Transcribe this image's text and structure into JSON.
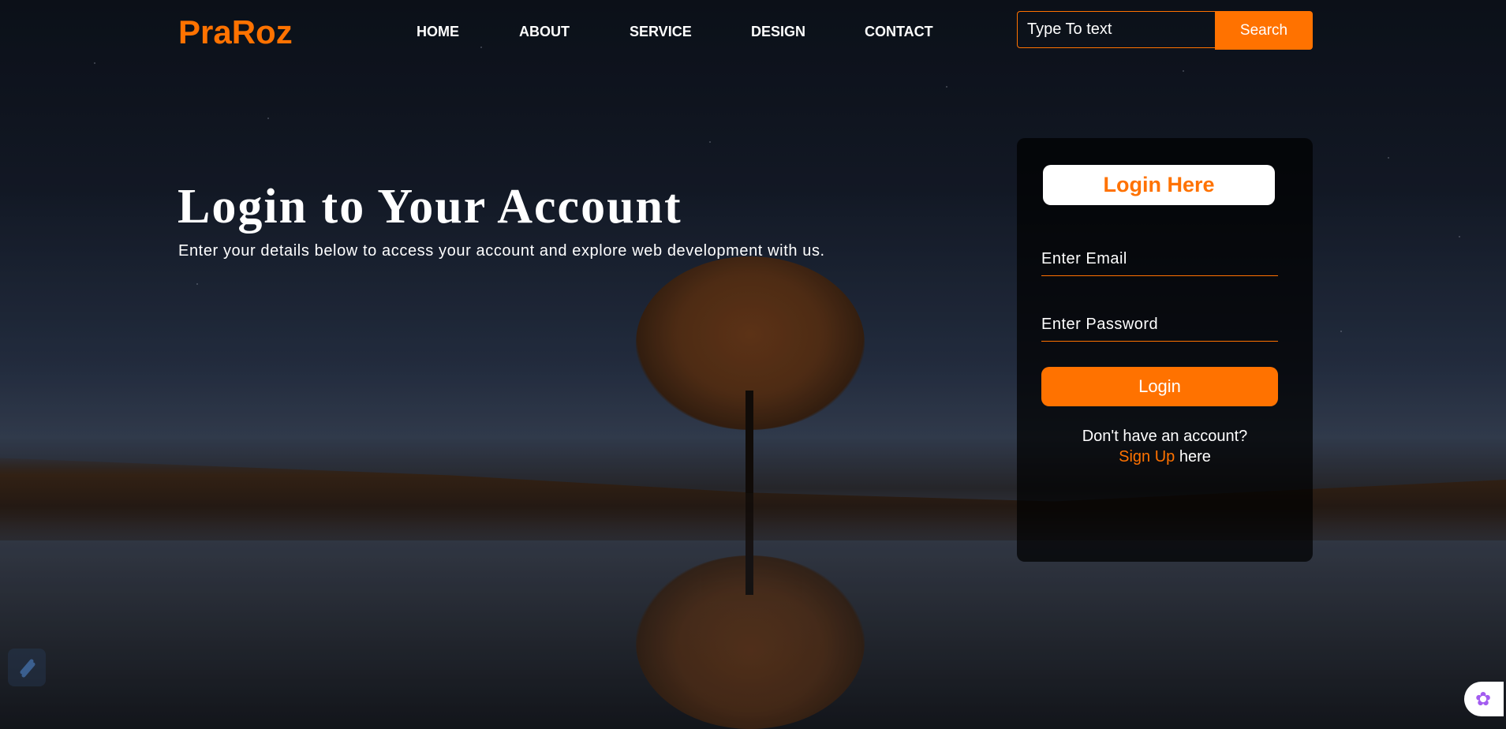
{
  "header": {
    "logo": "PraRoz",
    "nav": [
      "HOME",
      "ABOUT",
      "SERVICE",
      "DESIGN",
      "CONTACT"
    ],
    "search_placeholder": "Type To text",
    "search_button": "Search"
  },
  "hero": {
    "title": "Login to Your Account",
    "subtitle": "Enter your details below to access your account and explore web development with us."
  },
  "login": {
    "title": "Login Here",
    "email_placeholder": "Enter Email",
    "password_placeholder": "Enter Password",
    "button": "Login",
    "no_account": "Don't have an account?",
    "signup_link": "Sign Up",
    "signup_suffix": "here"
  },
  "colors": {
    "accent": "#ff7200"
  },
  "icons": {
    "bottom_left": "extension-icon",
    "bottom_right": "brain-icon"
  }
}
